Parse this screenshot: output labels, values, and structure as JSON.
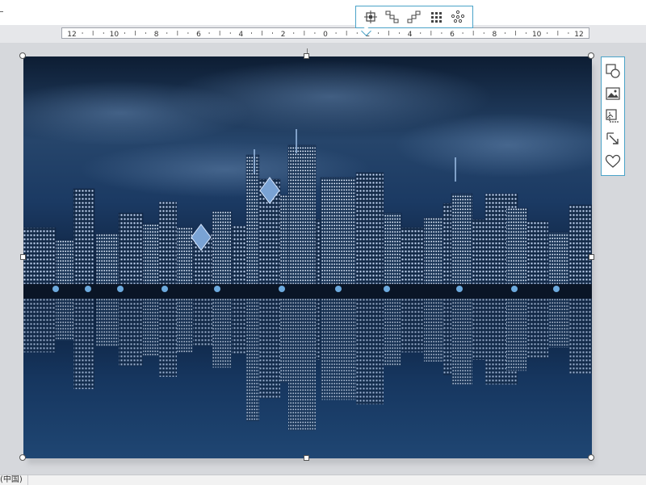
{
  "floating_toolbar": {
    "buttons": [
      {
        "icon": "crop-center-icon"
      },
      {
        "icon": "stagger-down-icon"
      },
      {
        "icon": "stairs-up-icon"
      },
      {
        "icon": "grid-dots-icon"
      },
      {
        "icon": "scatter-dots-icon"
      }
    ]
  },
  "ruler": {
    "labels": [
      "12",
      "10",
      "8",
      "6",
      "4",
      "2",
      "0",
      "2",
      "4",
      "6",
      "8",
      "10",
      "12"
    ]
  },
  "side_toolbar": {
    "buttons": [
      {
        "icon": "shape-insert-icon"
      },
      {
        "icon": "image-icon"
      },
      {
        "icon": "crop-image-icon"
      },
      {
        "icon": "resize-arrow-icon"
      },
      {
        "icon": "heart-icon"
      }
    ]
  },
  "status_bar": {
    "language": "(中国)"
  },
  "image": {
    "subject": "night city skyline with water reflection",
    "tint_color": "#1f4f86"
  },
  "colors": {
    "accent": "#4aa3c8",
    "canvas_bg": "#d6d8dc"
  }
}
